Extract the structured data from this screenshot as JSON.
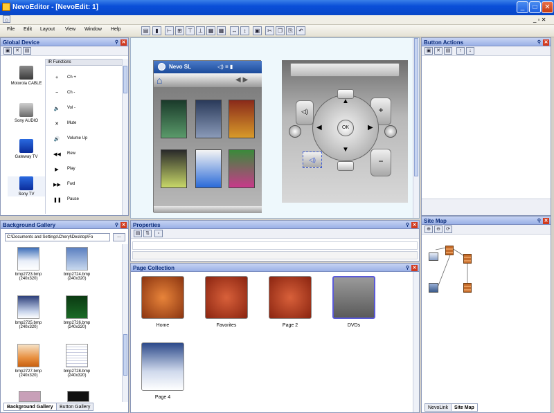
{
  "window": {
    "title": "NevoEditor - [NevoEdit: 1]"
  },
  "menu": [
    "File",
    "Edit",
    "Layout",
    "View",
    "Window",
    "Help"
  ],
  "panels": {
    "global_device": "Global Device",
    "ir_functions_header": "IR Functions",
    "button_actions": "Button Actions",
    "background_gallery": "Background Gallery",
    "properties": "Properties",
    "page_collection": "Page Collection",
    "site_map": "Site Map"
  },
  "devices": [
    {
      "label": "Motorola CABLE"
    },
    {
      "label": "Sony AUDIO"
    },
    {
      "label": "Gateway TV"
    },
    {
      "label": "Sony TV"
    }
  ],
  "ir_functions": [
    {
      "icon": "+",
      "label": "Ch +"
    },
    {
      "icon": "−",
      "label": "Ch -"
    },
    {
      "icon": "🔈",
      "label": "Vol -"
    },
    {
      "icon": "✕",
      "label": "Mute"
    },
    {
      "icon": "🔊",
      "label": "Volume Up"
    },
    {
      "icon": "◀◀",
      "label": "Rew"
    },
    {
      "icon": "▶",
      "label": "Play"
    },
    {
      "icon": "▶▶",
      "label": "Fwd"
    },
    {
      "icon": "❚❚",
      "label": "Pause"
    }
  ],
  "gallery": {
    "path": "C:\\Documents and Settings\\Cheryl\\Desktop\\Fo",
    "browse": "...",
    "items": [
      {
        "name": "bmp2723.bmp",
        "size": "(240x320)",
        "color": "linear-gradient(#3b6db8,#e8eef8 60%,#fff)"
      },
      {
        "name": "bmp2724.bmp",
        "size": "(240x320)",
        "color": "linear-gradient(#5a7fc0,#c8d8ee)"
      },
      {
        "name": "bmp2725.bmp",
        "size": "(240x320)",
        "color": "linear-gradient(#2d3f7a,#c8d4ec 70%,#fff)"
      },
      {
        "name": "bmp2726.bmp",
        "size": "(240x320)",
        "color": "linear-gradient(#0b3a12,#1a6a26)"
      },
      {
        "name": "bmp2727.bmp",
        "size": "(240x320)",
        "color": "linear-gradient(#f6e2c6,#e89040 60%,#c86010)"
      },
      {
        "name": "bmp2728.bmp",
        "size": "(240x320)",
        "color": "repeating-linear-gradient(#fff 0 3px,#c8cce0 3px 4px)"
      }
    ]
  },
  "bottom_tabs_left": [
    "Background Gallery",
    "Button Gallery"
  ],
  "bottom_tabs_right": [
    "NevoLink",
    "Site Map"
  ],
  "phone": {
    "title": "Nevo SL"
  },
  "pages": [
    {
      "label": "Home",
      "color": "radial-gradient(#e8843a,#8a3410)"
    },
    {
      "label": "Favorites",
      "color": "radial-gradient(#d8603a,#8a2410)"
    },
    {
      "label": "Page 2",
      "color": "radial-gradient(#d8603a,#8a2410)"
    },
    {
      "label": "DVDs",
      "color": "linear-gradient(#9a9a9a,#5a5a5a)"
    },
    {
      "label": "Page 4",
      "color": "linear-gradient(#2d4a8a,#cfd9ec 60%,#fff)"
    }
  ],
  "remote": {
    "ok_label": "OK"
  }
}
